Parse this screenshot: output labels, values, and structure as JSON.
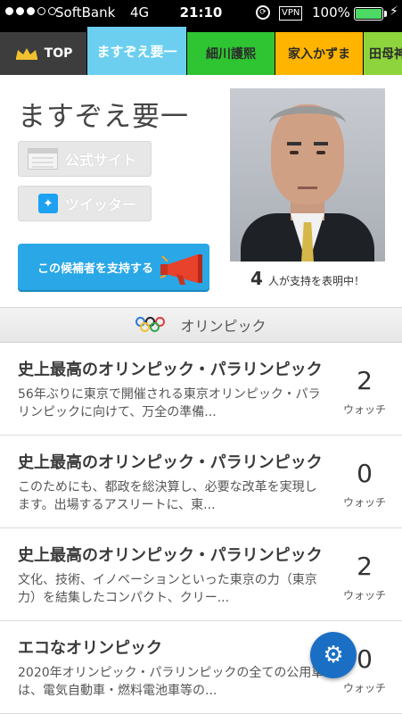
{
  "status_bar": {
    "carrier": "SoftBank",
    "network": "4G",
    "time": "21:10",
    "vpn": "VPN",
    "battery_percent": "100%",
    "battery_level": 1.0
  },
  "tabs": [
    {
      "label": "TOP"
    },
    {
      "label": "ますぞえ要一"
    },
    {
      "label": "細川護熙"
    },
    {
      "label": "家入かずま"
    },
    {
      "label": "田母神"
    }
  ],
  "profile": {
    "name": "ますぞえ要一",
    "official_site_label": "公式サイト",
    "twitter_label": "ツイッター",
    "support_button_label": "この候補者を支持する",
    "supporter_count": "4",
    "supporter_text": "人が支持を表明中！"
  },
  "category": {
    "label": "オリンピック"
  },
  "items": [
    {
      "title": "史上最高のオリンピック・パラリンピック",
      "desc": "56年ぶりに東京で開催される東京オリンピック・パラリンピックに向けて、万全の準備...",
      "count": "2",
      "watch_label": "ウォッチ"
    },
    {
      "title": "史上最高のオリンピック・パラリンピック",
      "desc": "このためにも、都政を総決算し、必要な改革を実現します。出場するアスリートに、東...",
      "count": "0",
      "watch_label": "ウォッチ"
    },
    {
      "title": "史上最高のオリンピック・パラリンピック",
      "desc": "文化、技術、イノベーションといった東京の力（東京力）を結集したコンパクト、クリー...",
      "count": "2",
      "watch_label": "ウォッチ"
    },
    {
      "title": "エコなオリンピック",
      "desc": "2020年オリンピック・パラリンピックの全ての公用車は、電気自動車・燃料電池車等の...",
      "count": "0",
      "watch_label": "ウォッチ"
    }
  ]
}
